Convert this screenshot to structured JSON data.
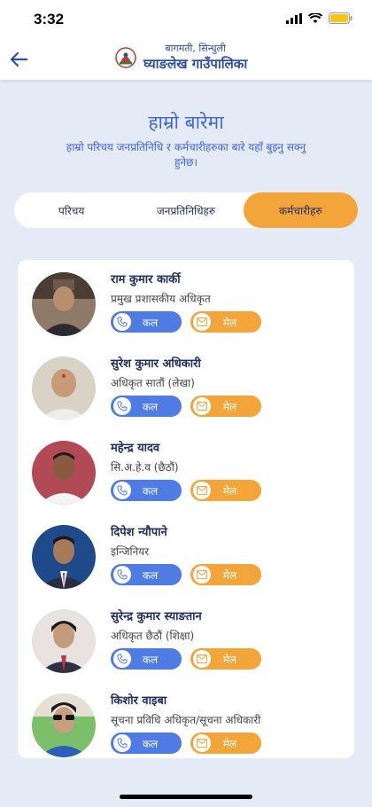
{
  "status_bar": {
    "time": "3:32"
  },
  "header": {
    "subtitle": "बागमती, सिन्धुली",
    "title": "घ्याङलेख गाउँपालिका"
  },
  "section": {
    "title": "हाम्रो बारेमा",
    "description": "हाम्रो परिचय जनप्रतिनिधि र कर्मचारीहरुका बारे यहाँ बुझ्नु सक्नु हुनेछ।"
  },
  "tabs": [
    {
      "label": "परिचय",
      "active": false
    },
    {
      "label": "जनप्रतिनिधिहरु",
      "active": false
    },
    {
      "label": "कर्मचारीहरु",
      "active": true
    }
  ],
  "buttons": {
    "call": "कल",
    "mail": "मेल"
  },
  "staff": [
    {
      "name": "राम कुमार कार्की",
      "role": "प्रमुख प्रशासकीय अधिकृत"
    },
    {
      "name": "सुरेश कुमार अधिकारी",
      "role": "अधिकृत सातौं (लेखा)"
    },
    {
      "name": "महेन्द्र यादव",
      "role": "सि.अ.हे.व (छैठौं)"
    },
    {
      "name": "दिपेश न्यौपाने",
      "role": "इन्जिनियर"
    },
    {
      "name": "सुरेन्द्र कुमार स्याङतान",
      "role": "अधिकृत छैठौं (शिक्षा)"
    },
    {
      "name": "किशोर वाइबा",
      "role": "सूचना प्रविधि अधिकृत/सूचना अधिकारी"
    }
  ],
  "colors": {
    "primary": "#4f7be4",
    "accent": "#f3a53a",
    "background": "#e4ebf7",
    "text_dark": "#1f2d5a"
  },
  "icons": {
    "back": "back-arrow-icon",
    "call": "phone-icon",
    "mail": "mail-icon",
    "emblem": "nepal-emblem-icon"
  }
}
